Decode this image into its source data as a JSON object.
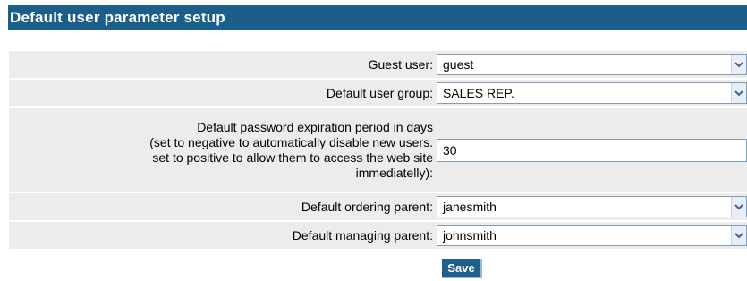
{
  "title": "Default user parameter setup",
  "form": {
    "guest_user": {
      "label": "Guest user:",
      "value": "guest"
    },
    "default_user_group": {
      "label": "Default user group:",
      "value": "SALES REP."
    },
    "password_expiration": {
      "label_lines": [
        "Default password expiration period in days",
        "(set to negative to automatically disable new users.",
        "set to positive to allow them to access the web site",
        "immediatelly):"
      ],
      "value": "30"
    },
    "default_ordering_parent": {
      "label": "Default ordering parent:",
      "value": "janesmith"
    },
    "default_managing_parent": {
      "label": "Default managing parent:",
      "value": "johnsmith"
    }
  },
  "save_label": "Save",
  "icons": {
    "dropdown": "chevron-down-icon"
  }
}
